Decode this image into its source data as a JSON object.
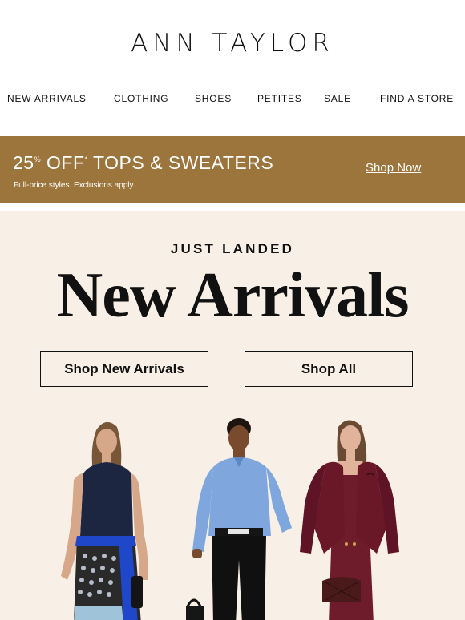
{
  "brand": {
    "logo_text": "ANN TAYLOR"
  },
  "nav": {
    "items": [
      {
        "label": "NEW ARRIVALS"
      },
      {
        "label": "CLOTHING"
      },
      {
        "label": "SHOES"
      },
      {
        "label": "PETITES"
      },
      {
        "label": "SALE"
      },
      {
        "label": "FIND A STORE"
      }
    ]
  },
  "promo": {
    "percent": "25",
    "percent_sign": "%",
    "off": " OFF",
    "asterisk": "*",
    "category": " TOPS & SWEATERS",
    "subtext": "Full-price styles. Exclusions apply.",
    "cta": "Shop Now",
    "background_color": "#9b753c"
  },
  "hero": {
    "eyebrow": "JUST LANDED",
    "title": "New Arrivals",
    "buttons": {
      "primary": "Shop New Arrivals",
      "secondary": "Shop All"
    },
    "background_color": "#f8f0e6"
  }
}
